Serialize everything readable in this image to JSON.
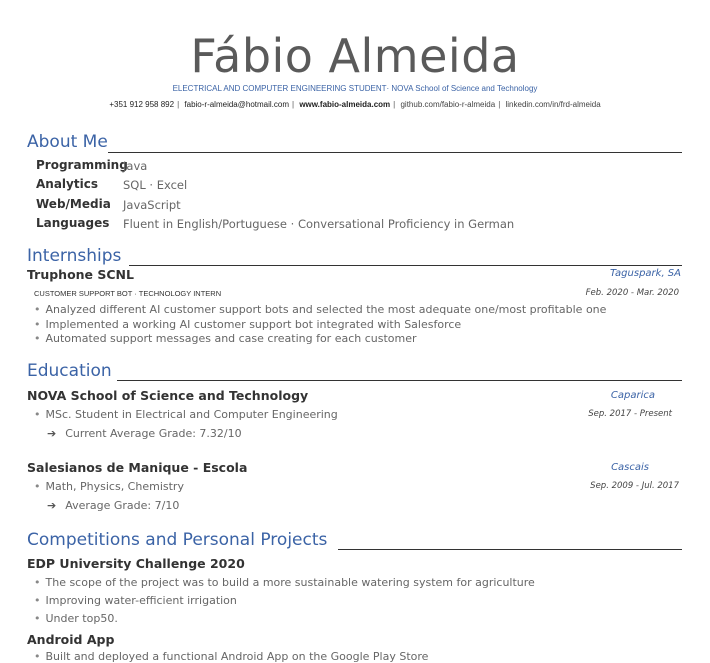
{
  "header": {
    "name": "Fábio Almeida",
    "subtitle": "ELECTRICAL AND COMPUTER ENGINEERING STUDENT· NOVA School of Science and Technology",
    "phone": "+351 912 958 892",
    "email": "fabio-r-almeida@hotmail.com",
    "website": "www.fabio-almeida.com",
    "github": "github.com/fabio-r-almeida",
    "linkedin": "linkedin.com/in/frd-almeida"
  },
  "about": {
    "title": "About Me",
    "skills": [
      {
        "label": "Programming",
        "value": "Java"
      },
      {
        "label": "Analytics",
        "value": "SQL · Excel"
      },
      {
        "label": "Web/Media",
        "value": "JavaScript"
      },
      {
        "label": "Languages",
        "value": "Fluent in English/Portuguese · Conversational Proficiency in German"
      }
    ]
  },
  "internships": {
    "title": "Internships",
    "entries": [
      {
        "company": "Truphone SCNL",
        "location": "Taguspark, SA",
        "role": "CUSTOMER SUPPORT BOT · TECHNOLOGY INTERN",
        "date": "Feb. 2020 - Mar. 2020",
        "bullets": [
          "Analyzed different AI customer support bots and selected the most adequate one/most profitable one",
          "Implemented a working AI customer support bot integrated with Salesforce",
          "Automated support messages and case creating for each customer"
        ]
      }
    ]
  },
  "education": {
    "title": "Education",
    "entries": [
      {
        "school": "NOVA School of Science and Technology",
        "location": "Caparica",
        "detail": "MSc. Student in Electrical and Computer Engineering",
        "date": "Sep.  2017 - Present",
        "sub": "Current Average Grade: 7.32/10"
      },
      {
        "school": "Salesianos de Manique - Escola",
        "location": "Cascais",
        "detail": "Math, Physics, Chemistry",
        "date": "Sep.  2009 - Jul. 2017",
        "sub": "Average Grade: 7/10"
      }
    ]
  },
  "projects": {
    "title": "Competitions and Personal Projects",
    "entries": [
      {
        "name": "EDP University Challenge 2020",
        "bullets": [
          "The scope of the project was to build a more sustainable watering system for agriculture",
          "Improving water-efficient irrigation",
          "Under top50."
        ]
      },
      {
        "name": "Android App",
        "bullets": [
          "Built and deployed a functional Android App on the Google Play Store"
        ]
      }
    ]
  }
}
